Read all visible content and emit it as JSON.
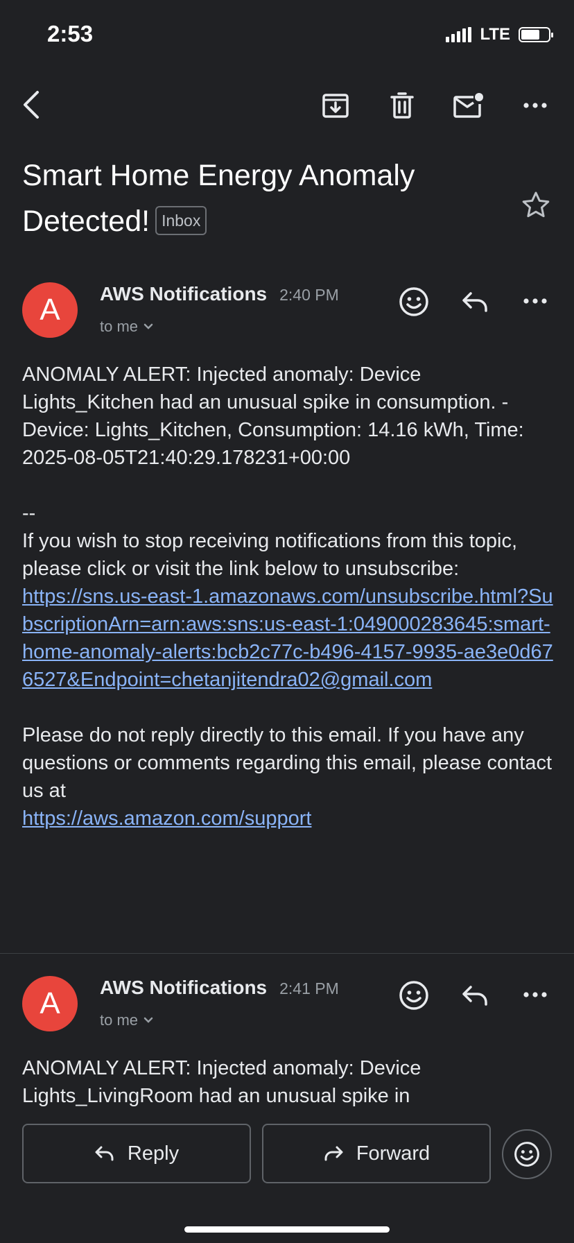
{
  "status_bar": {
    "time": "2:53",
    "network": "LTE"
  },
  "toolbar": {
    "back": "back-arrow-icon",
    "archive": "archive-icon",
    "delete": "trash-icon",
    "mark_unread": "mark-unread-icon",
    "more": "more-horizontal-icon"
  },
  "subject": {
    "title": "Smart Home Energy Anomaly Detected!",
    "label": "Inbox"
  },
  "messages": [
    {
      "avatar_letter": "A",
      "sender": "AWS Notifications",
      "time": "2:40 PM",
      "recipient": "to me",
      "body_line": "ANOMALY ALERT: Injected anomaly: Device Lights_Kitchen had an unusual spike in consumption. - Device: Lights_Kitchen, Consumption: 14.16 kWh, Time: 2025-08-05T21:40:29.178231+00:00",
      "separator": "--",
      "unsubscribe_text": "If you wish to stop receiving notifications from this topic, please click or visit the link below to unsubscribe:",
      "unsubscribe_link": "https://sns.us-east-1.amazonaws.com/unsubscribe.html?SubscriptionArn=arn:aws:sns:us-east-1:049000283645:smart-home-anomaly-alerts:bcb2c77c-b496-4157-9935-ae3e0d676527&Endpoint=chetanjitendra02@gmail.com",
      "footer_text": "Please do not reply directly to this email. If you have any questions or comments regarding this email, please contact us at",
      "support_link": "https://aws.amazon.com/support"
    },
    {
      "avatar_letter": "A",
      "sender": "AWS Notifications",
      "time": "2:41 PM",
      "recipient": "to me",
      "body_preview": "ANOMALY ALERT: Injected anomaly: Device Lights_LivingRoom had an unusual spike in"
    }
  ],
  "actions": {
    "reply": "Reply",
    "forward": "Forward"
  },
  "colors": {
    "background": "#202124",
    "avatar": "#e8453c",
    "link": "#8ab4f8"
  }
}
